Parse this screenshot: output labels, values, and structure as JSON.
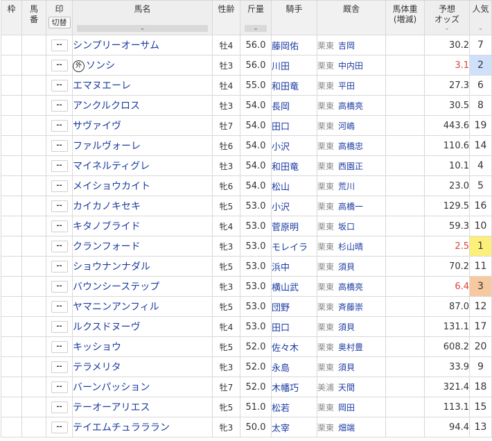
{
  "header": {
    "waku": "枠",
    "umaban": "馬\n番",
    "mark": "印",
    "mark_toggle": "切替",
    "horse_name": "馬名",
    "sex_age": "性齢",
    "weight": "斤量",
    "jockey": "騎手",
    "stable": "厩舎",
    "body_weight": "馬体重\n(増減)",
    "odds": "予想\nオッズ",
    "popularity": "人気"
  },
  "sort_caret": "⌄",
  "mark_placeholder": "--",
  "foreign_badge": "外",
  "rows": [
    {
      "name": "シンプリーオーサム",
      "foreign": false,
      "sex_age": "牡4",
      "weight": "56.0",
      "jockey": "藤岡佑",
      "region": "栗東",
      "trainer": "吉岡",
      "odds": "30.2",
      "pop": "7"
    },
    {
      "name": "ソンシ",
      "foreign": true,
      "sex_age": "牡3",
      "weight": "56.0",
      "jockey": "川田",
      "region": "栗東",
      "trainer": "中内田",
      "odds": "3.1",
      "pop": "2"
    },
    {
      "name": "エマヌエーレ",
      "foreign": false,
      "sex_age": "牡4",
      "weight": "55.0",
      "jockey": "和田竜",
      "region": "栗東",
      "trainer": "平田",
      "odds": "27.3",
      "pop": "6"
    },
    {
      "name": "アンクルクロス",
      "foreign": false,
      "sex_age": "牡3",
      "weight": "54.0",
      "jockey": "長岡",
      "region": "栗東",
      "trainer": "高橋亮",
      "odds": "30.5",
      "pop": "8"
    },
    {
      "name": "サヴァイヴ",
      "foreign": false,
      "sex_age": "牡7",
      "weight": "54.0",
      "jockey": "田口",
      "region": "栗東",
      "trainer": "河嶋",
      "odds": "443.6",
      "pop": "19"
    },
    {
      "name": "ファルヴォーレ",
      "foreign": false,
      "sex_age": "牡6",
      "weight": "54.0",
      "jockey": "小沢",
      "region": "栗東",
      "trainer": "高橋忠",
      "odds": "110.6",
      "pop": "14"
    },
    {
      "name": "マイネルティグレ",
      "foreign": false,
      "sex_age": "牡3",
      "weight": "54.0",
      "jockey": "和田竜",
      "region": "栗東",
      "trainer": "西園正",
      "odds": "10.1",
      "pop": "4"
    },
    {
      "name": "メイショウカイト",
      "foreign": false,
      "sex_age": "牝6",
      "weight": "54.0",
      "jockey": "松山",
      "region": "栗東",
      "trainer": "荒川",
      "odds": "23.0",
      "pop": "5"
    },
    {
      "name": "カイカノキセキ",
      "foreign": false,
      "sex_age": "牝5",
      "weight": "53.0",
      "jockey": "小沢",
      "region": "栗東",
      "trainer": "高橋一",
      "odds": "129.5",
      "pop": "16"
    },
    {
      "name": "キタノブライド",
      "foreign": false,
      "sex_age": "牝4",
      "weight": "53.0",
      "jockey": "菅原明",
      "region": "栗東",
      "trainer": "坂口",
      "odds": "59.3",
      "pop": "10"
    },
    {
      "name": "クランフォード",
      "foreign": false,
      "sex_age": "牝3",
      "weight": "53.0",
      "jockey": "モレイラ",
      "region": "栗東",
      "trainer": "杉山晴",
      "odds": "2.5",
      "pop": "1"
    },
    {
      "name": "ショウナンナダル",
      "foreign": false,
      "sex_age": "牝5",
      "weight": "53.0",
      "jockey": "浜中",
      "region": "栗東",
      "trainer": "須貝",
      "odds": "70.2",
      "pop": "11"
    },
    {
      "name": "バウンシーステップ",
      "foreign": false,
      "sex_age": "牝3",
      "weight": "53.0",
      "jockey": "横山武",
      "region": "栗東",
      "trainer": "高橋亮",
      "odds": "6.4",
      "pop": "3"
    },
    {
      "name": "ヤマニンアンフィル",
      "foreign": false,
      "sex_age": "牝5",
      "weight": "53.0",
      "jockey": "団野",
      "region": "栗東",
      "trainer": "斉藤崇",
      "odds": "87.0",
      "pop": "12"
    },
    {
      "name": "ルクスドヌーヴ",
      "foreign": false,
      "sex_age": "牝4",
      "weight": "53.0",
      "jockey": "田口",
      "region": "栗東",
      "trainer": "須貝",
      "odds": "131.1",
      "pop": "17"
    },
    {
      "name": "キッショウ",
      "foreign": false,
      "sex_age": "牝5",
      "weight": "52.0",
      "jockey": "佐々木",
      "region": "栗東",
      "trainer": "奥村豊",
      "odds": "608.2",
      "pop": "20"
    },
    {
      "name": "テラメリタ",
      "foreign": false,
      "sex_age": "牝3",
      "weight": "52.0",
      "jockey": "永島",
      "region": "栗東",
      "trainer": "須貝",
      "odds": "33.9",
      "pop": "9"
    },
    {
      "name": "バーンパッション",
      "foreign": false,
      "sex_age": "牡7",
      "weight": "52.0",
      "jockey": "木幡巧",
      "region": "美浦",
      "trainer": "天間",
      "odds": "321.4",
      "pop": "18"
    },
    {
      "name": "テーオーアリエス",
      "foreign": false,
      "sex_age": "牝5",
      "weight": "51.0",
      "jockey": "松若",
      "region": "栗東",
      "trainer": "岡田",
      "odds": "113.1",
      "pop": "15"
    },
    {
      "name": "テイエムチュラララン",
      "foreign": false,
      "sex_age": "牝3",
      "weight": "50.0",
      "jockey": "太宰",
      "region": "栗東",
      "trainer": "畑端",
      "odds": "94.4",
      "pop": "13"
    }
  ],
  "colors": {
    "link": "#1a3aa1",
    "favorite_odds": "#d9423c",
    "pop_1": "#fcf07a",
    "pop_2": "#cfe0fa",
    "pop_3": "#f6c9a0"
  }
}
